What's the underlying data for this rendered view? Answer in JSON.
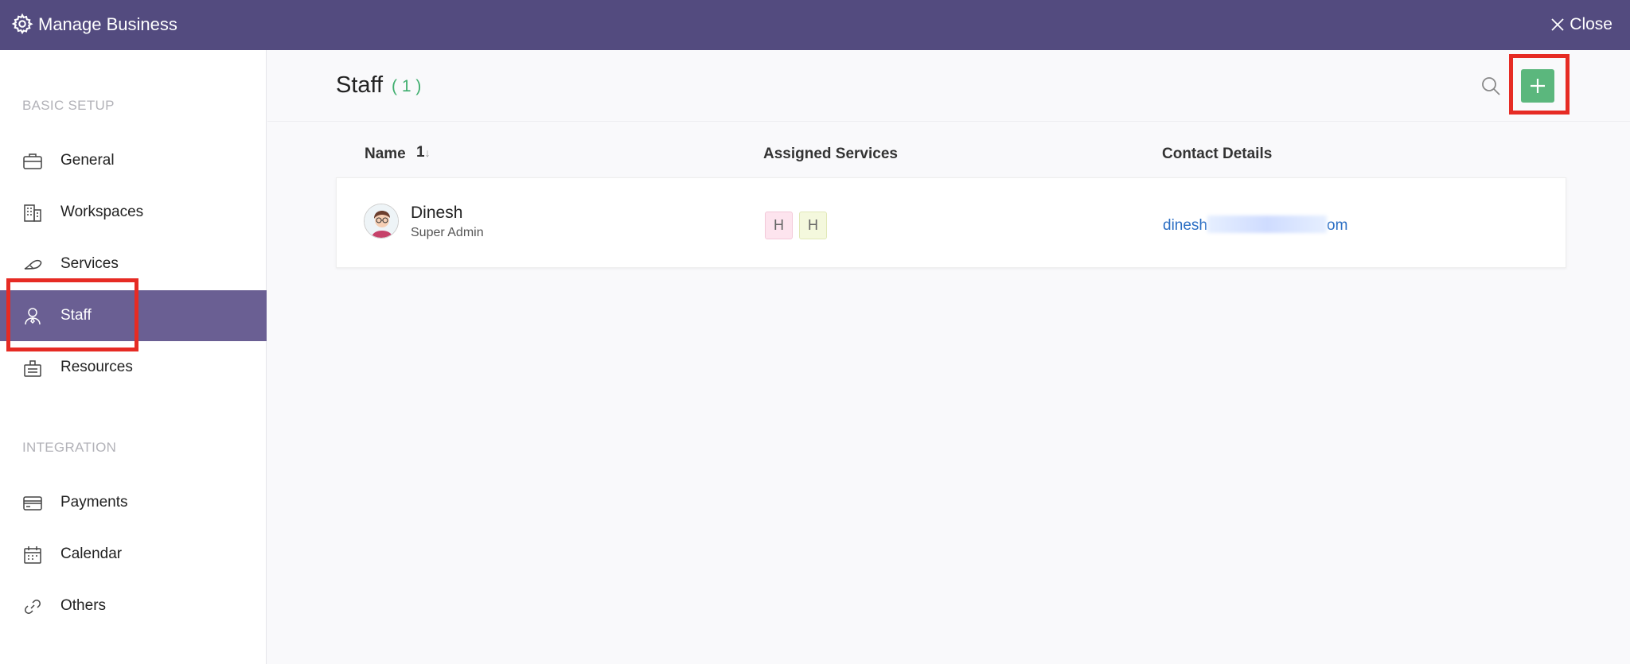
{
  "topbar": {
    "title": "Manage Business",
    "close_label": "Close"
  },
  "sidebar": {
    "sections": [
      {
        "label": "BASIC SETUP"
      },
      {
        "label": "INTEGRATION"
      }
    ],
    "items": [
      {
        "label": "General",
        "icon": "briefcase-icon"
      },
      {
        "label": "Workspaces",
        "icon": "building-icon"
      },
      {
        "label": "Services",
        "icon": "services-icon"
      },
      {
        "label": "Staff",
        "icon": "staff-icon",
        "active": true
      },
      {
        "label": "Resources",
        "icon": "resources-icon"
      },
      {
        "label": "Payments",
        "icon": "card-icon"
      },
      {
        "label": "Calendar",
        "icon": "calendar-icon"
      },
      {
        "label": "Others",
        "icon": "link-icon"
      }
    ]
  },
  "main": {
    "title": "Staff",
    "count": "( 1 )",
    "columns": {
      "name": "Name",
      "sort_glyph": "1",
      "services": "Assigned Services",
      "contact": "Contact Details"
    },
    "rows": [
      {
        "name": "Dinesh",
        "role": "Super Admin",
        "services": [
          "H",
          "H"
        ],
        "email_start": "dinesh",
        "email_end": "om"
      }
    ]
  },
  "colors": {
    "topbar": "#534b7f",
    "active_nav": "#6a5f93",
    "add_button": "#5bb77d",
    "count": "#3fae6e",
    "highlight": "#e62b24",
    "link": "#2c6fc4"
  }
}
